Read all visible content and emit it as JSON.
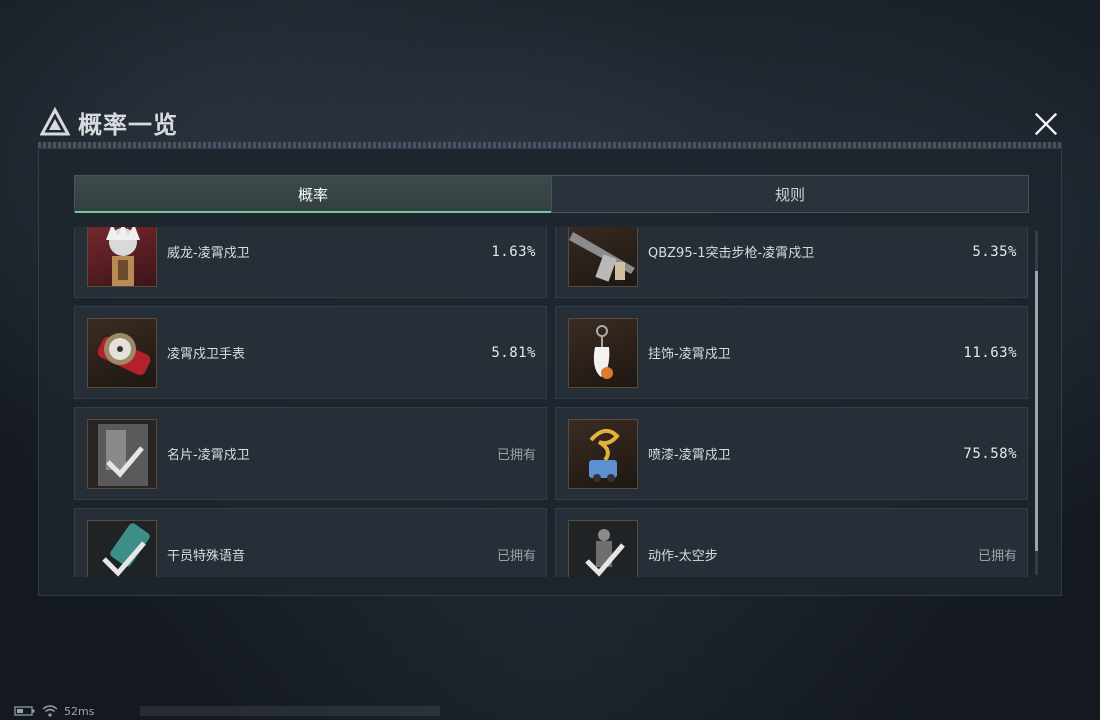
{
  "dialog": {
    "title": "概率一览"
  },
  "tabs": [
    {
      "label": "概率",
      "active": true
    },
    {
      "label": "规则",
      "active": false
    }
  ],
  "items": [
    {
      "name": "威龙-凌霄戍卫",
      "value": "1.63%",
      "owned": false,
      "icon": "operator-skin-icon"
    },
    {
      "name": "QBZ95-1突击步枪-凌霄戍卫",
      "value": "5.35%",
      "owned": false,
      "icon": "rifle-skin-icon"
    },
    {
      "name": "凌霄戍卫手表",
      "value": "5.81%",
      "owned": false,
      "icon": "watch-icon"
    },
    {
      "name": "挂饰-凌霄戍卫",
      "value": "11.63%",
      "owned": false,
      "icon": "charm-icon"
    },
    {
      "name": "名片-凌霄戍卫",
      "value": "已拥有",
      "owned": true,
      "icon": "name-card-icon"
    },
    {
      "name": "喷漆-凌霄戍卫",
      "value": "75.58%",
      "owned": false,
      "icon": "spray-icon"
    },
    {
      "name": "干员特殊语音",
      "value": "已拥有",
      "owned": true,
      "icon": "voice-icon"
    },
    {
      "name": "动作-太空步",
      "value": "已拥有",
      "owned": true,
      "icon": "emote-icon"
    }
  ],
  "status": {
    "ping": "52ms"
  },
  "colors": {
    "accent": "#79c3a4",
    "card_bg": "#262e37",
    "panel_bg": "#1d242c"
  }
}
